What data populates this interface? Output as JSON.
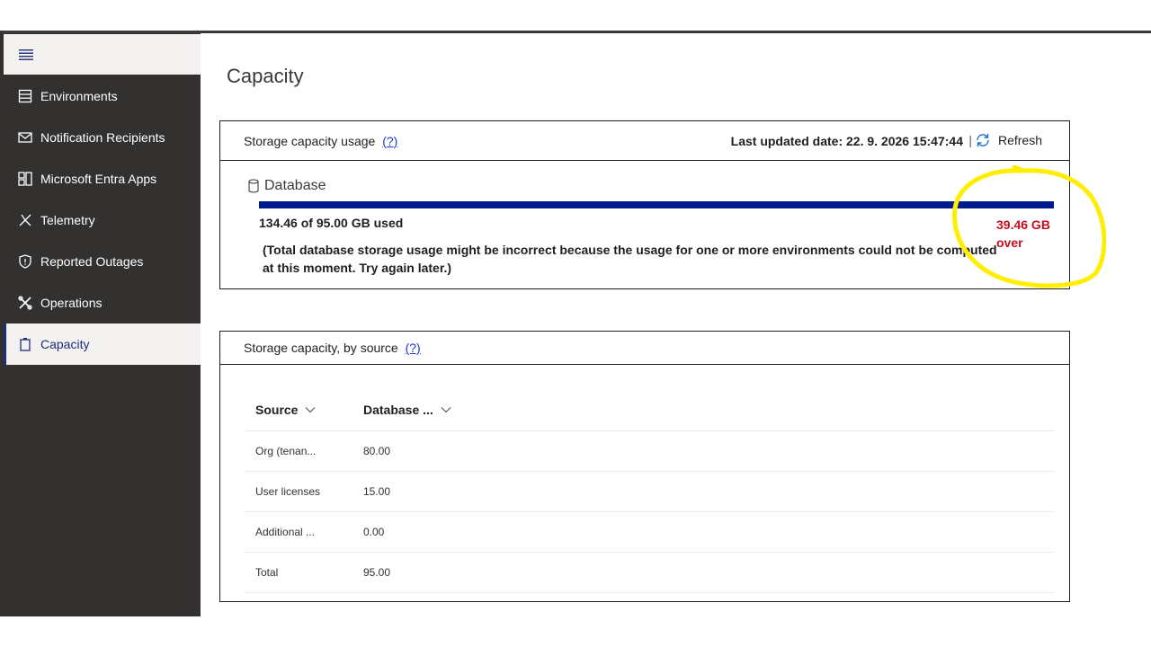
{
  "sidebar": {
    "items": [
      {
        "label": "Environments",
        "icon": "server-icon",
        "active": false
      },
      {
        "label": "Notification Recipients",
        "icon": "mail-icon",
        "active": false
      },
      {
        "label": "Microsoft Entra Apps",
        "icon": "apps-icon",
        "active": false
      },
      {
        "label": "Telemetry",
        "icon": "telemetry-icon",
        "active": false
      },
      {
        "label": "Reported Outages",
        "icon": "shield-icon",
        "active": false
      },
      {
        "label": "Operations",
        "icon": "tools-icon",
        "active": false
      },
      {
        "label": "Capacity",
        "icon": "battery-icon",
        "active": true
      }
    ]
  },
  "page": {
    "title": "Capacity"
  },
  "storage_usage": {
    "title": "Storage capacity usage",
    "help": "(?)",
    "last_updated": "Last updated date: 22. 9. 2026 15:47:44",
    "separator": "|",
    "refresh_label": "Refresh",
    "database_label": "Database",
    "used_text": "134.46 of 95.00 GB used",
    "used_fraction": 1.0,
    "over_text": "39.46 GB over",
    "note": "(Total database storage usage might be incorrect because the usage for one or more environments could not be computed at this moment. Try again later.)"
  },
  "by_source": {
    "title": "Storage capacity, by source",
    "help": "(?)",
    "columns": [
      "Source",
      "Database ..."
    ],
    "rows": [
      [
        "Org (tenan...",
        "80.00"
      ],
      [
        "User licenses",
        "15.00"
      ],
      [
        "Additional ...",
        "0.00"
      ],
      [
        "Total",
        "95.00"
      ]
    ]
  },
  "colors": {
    "sidebar_bg": "#323130",
    "accent": "#1f2d7a",
    "bar_fill": "#001a8c",
    "over_red": "#c50f1f",
    "highlight_yellow": "#ffee00"
  }
}
